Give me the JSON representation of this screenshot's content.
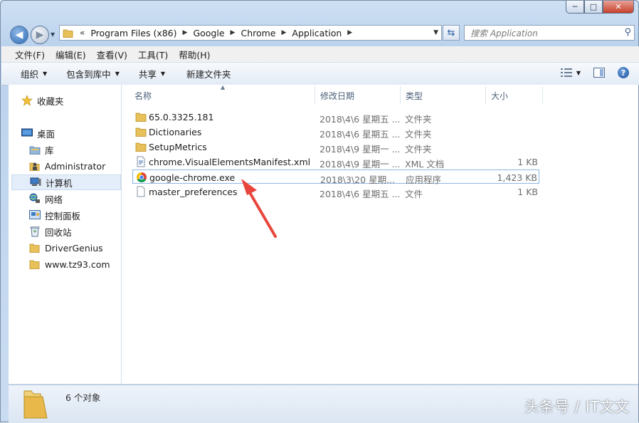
{
  "window": {
    "controls": {
      "minimize": "─",
      "maximize": "□",
      "close": "✕"
    }
  },
  "address": {
    "overflow": "«",
    "crumbs": [
      "Program Files (x86)",
      "Google",
      "Chrome",
      "Application"
    ],
    "search_placeholder": "搜索 Application"
  },
  "menu": [
    "文件(F)",
    "编辑(E)",
    "查看(V)",
    "工具(T)",
    "帮助(H)"
  ],
  "toolbar": {
    "organize": "组织",
    "include": "包含到库中",
    "share": "共享",
    "new_folder": "新建文件夹"
  },
  "nav": {
    "favorites": "收藏夹",
    "desktop": "桌面",
    "library": "库",
    "admin": "Administrator",
    "computer": "计算机",
    "network": "网络",
    "control_panel": "控制面板",
    "recycle": "回收站",
    "driver_genius": "DriverGenius",
    "tz93": "www.tz93.com"
  },
  "columns": {
    "name": "名称",
    "date": "修改日期",
    "type": "类型",
    "size": "大小"
  },
  "files": [
    {
      "name": "65.0.3325.181",
      "date": "2018\\4\\6 星期五 ...",
      "type": "文件夹",
      "size": "",
      "icon": "folder-icon"
    },
    {
      "name": "Dictionaries",
      "date": "2018\\4\\6 星期五 ...",
      "type": "文件夹",
      "size": "",
      "icon": "folder-icon"
    },
    {
      "name": "SetupMetrics",
      "date": "2018\\4\\9 星期一 ...",
      "type": "文件夹",
      "size": "",
      "icon": "folder-icon"
    },
    {
      "name": "chrome.VisualElementsManifest.xml",
      "date": "2018\\4\\9 星期一 ...",
      "type": "XML 文档",
      "size": "1 KB",
      "icon": "xml-file-icon"
    },
    {
      "name": "google-chrome.exe",
      "date": "2018\\3\\20 星期...",
      "type": "应用程序",
      "size": "1,423 KB",
      "icon": "chrome-icon"
    },
    {
      "name": "master_preferences",
      "date": "2018\\4\\6 星期五 ...",
      "type": "文件",
      "size": "1 KB",
      "icon": "file-icon"
    }
  ],
  "status": {
    "count": "6 个对象"
  },
  "watermark": "头条号 / IT文文",
  "colors": {
    "annotation_arrow": "#e8453c",
    "selection_border": "#8fb6e1"
  }
}
